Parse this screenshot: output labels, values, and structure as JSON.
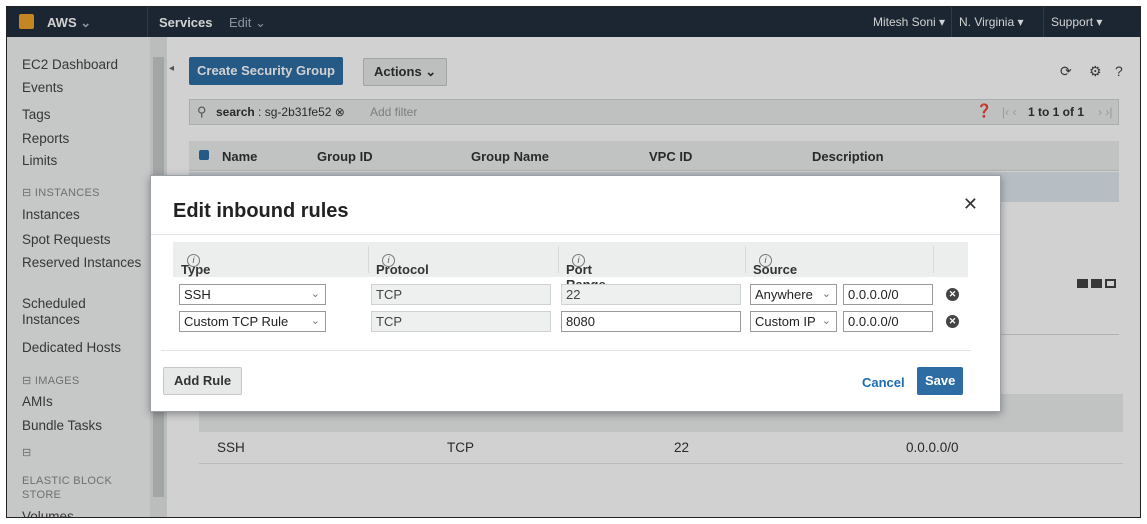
{
  "topbar": {
    "aws_label": "AWS",
    "services_label": "Services",
    "edit_label": "Edit",
    "user_label": "Mitesh Soni",
    "region_label": "N. Virginia",
    "support_label": "Support"
  },
  "sidebar": {
    "items": [
      {
        "label": "EC2 Dashboard"
      },
      {
        "label": "Events"
      },
      {
        "label": "Tags"
      },
      {
        "label": "Reports"
      },
      {
        "label": "Limits"
      },
      {
        "label": "Instances"
      },
      {
        "label": "Spot Requests"
      },
      {
        "label": "Reserved Instances"
      },
      {
        "label": "Scheduled Instances"
      },
      {
        "label": "Dedicated Hosts"
      },
      {
        "label": "AMIs"
      },
      {
        "label": "Bundle Tasks"
      },
      {
        "label": "Volumes"
      }
    ],
    "sections": {
      "instances": "INSTANCES",
      "images": "IMAGES",
      "ebs": "ELASTIC BLOCK STORE"
    }
  },
  "toolbar": {
    "create_label": "Create Security Group",
    "actions_label": "Actions"
  },
  "search": {
    "token_key": "search",
    "token_value": "sg-2b31fe52",
    "placeholder": "Add filter",
    "pagination": "1 to 1 of 1"
  },
  "table": {
    "columns": [
      "Name",
      "Group ID",
      "Group Name",
      "VPC ID",
      "Description"
    ]
  },
  "background_row": {
    "type": "SSH",
    "protocol": "TCP",
    "port": "22",
    "source": "0.0.0.0/0"
  },
  "modal": {
    "title": "Edit inbound rules",
    "columns": {
      "type": "Type",
      "protocol": "Protocol",
      "port_range": "Port Range",
      "source": "Source"
    },
    "rules": [
      {
        "type": "SSH",
        "protocol": "TCP",
        "port": "22",
        "source_type": "Anywhere",
        "cidr": "0.0.0.0/0"
      },
      {
        "type": "Custom TCP Rule",
        "protocol": "TCP",
        "port": "8080",
        "source_type": "Custom IP",
        "cidr": "0.0.0.0/0"
      }
    ],
    "add_rule_label": "Add Rule",
    "cancel_label": "Cancel",
    "save_label": "Save"
  },
  "colors": {
    "topbar": "#232f3e",
    "primary": "#2e6da4",
    "link": "#1a6db5"
  }
}
